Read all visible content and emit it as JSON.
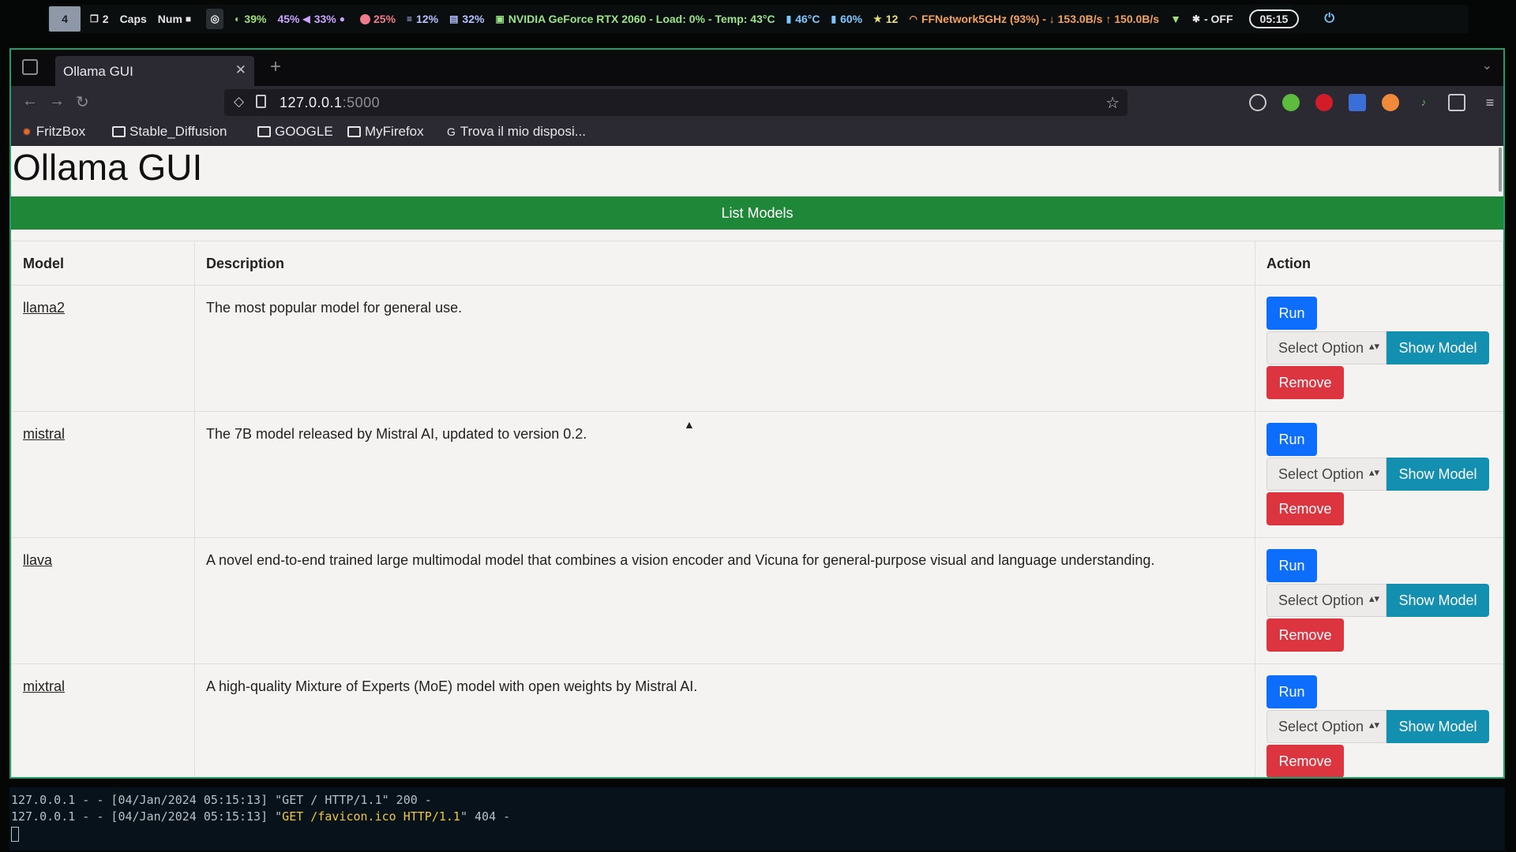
{
  "statusbar": {
    "workspace": "4",
    "windows": "2",
    "caps": "Caps",
    "num": "Num",
    "cpu": "39%",
    "volume": "45%",
    "mic": "33%",
    "mem": "25%",
    "disk1": "12%",
    "disk2": "32%",
    "gpu": "NVIDIA GeForce RTX 2060 - Load: 0% - Temp: 43°C",
    "temp": "46°C",
    "battery": "60%",
    "updates": "12",
    "network": "FFNetwork5GHz (93%) - ↓ 153.0B/s ↑ 150.0B/s",
    "bluetooth": "- OFF",
    "clock": "05:15"
  },
  "browser": {
    "tab_title": "Ollama GUI",
    "url_host": "127.0.0.1",
    "url_port": ":5000",
    "bookmarks": [
      "FritzBox",
      "Stable_Diffusion",
      "GOOGLE",
      "MyFirefox",
      "Trova il mio disposi..."
    ]
  },
  "page": {
    "title": "Ollama GUI",
    "list_models_label": "List Models",
    "columns": [
      "Model",
      "Description",
      "Action"
    ],
    "run_label": "Run",
    "select_label": "Select Option",
    "show_label": "Show Model",
    "remove_label": "Remove",
    "models": [
      {
        "name": "llama2",
        "description": "The most popular model for general use."
      },
      {
        "name": "mistral",
        "description": "The 7B model released by Mistral AI, updated to version 0.2."
      },
      {
        "name": "llava",
        "description": "A novel end-to-end trained large multimodal model that combines a vision encoder and Vicuna for general-purpose visual and language understanding."
      },
      {
        "name": "mixtral",
        "description": "A high-quality Mixture of Experts (MoE) model with open weights by Mistral AI."
      }
    ]
  },
  "terminal": {
    "lines": [
      {
        "prefix": "127.0.0.1 - - [04/Jan/2024 05:15:13] \"",
        "request": "GET / HTTP/1.1",
        "suffix": "\" 200 -"
      },
      {
        "prefix": "127.0.0.1 - - [04/Jan/2024 05:15:13] \"",
        "request": "GET /favicon.ico HTTP/1.1",
        "suffix": "\" 404 -"
      }
    ]
  }
}
